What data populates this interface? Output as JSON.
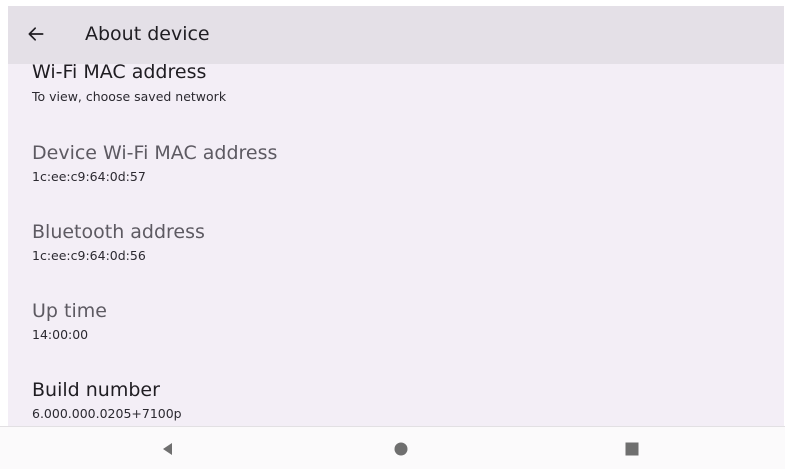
{
  "appbar": {
    "title": "About device",
    "back_icon": "arrow-left-icon"
  },
  "items": [
    {
      "label": "Wi-Fi MAC address",
      "value": "To view, choose saved network"
    },
    {
      "label": "Device Wi-Fi MAC address",
      "value": "1c:ee:c9:64:0d:57"
    },
    {
      "label": "Bluetooth address",
      "value": "1c:ee:c9:64:0d:56"
    },
    {
      "label": "Up time",
      "value": "14:00:00"
    },
    {
      "label": "Build number",
      "value": "6.000.000.0205+7100p"
    }
  ],
  "navbar": {
    "back_icon": "triangle-back-icon",
    "home_icon": "circle-home-icon",
    "recents_icon": "square-recents-icon"
  },
  "colors": {
    "app_background": "#f3eef6",
    "appbar_background": "#e4e0e7",
    "text_primary": "#1f1d22",
    "text_muted": "#5d5a62",
    "nav_icon": "#6f6f6f"
  }
}
